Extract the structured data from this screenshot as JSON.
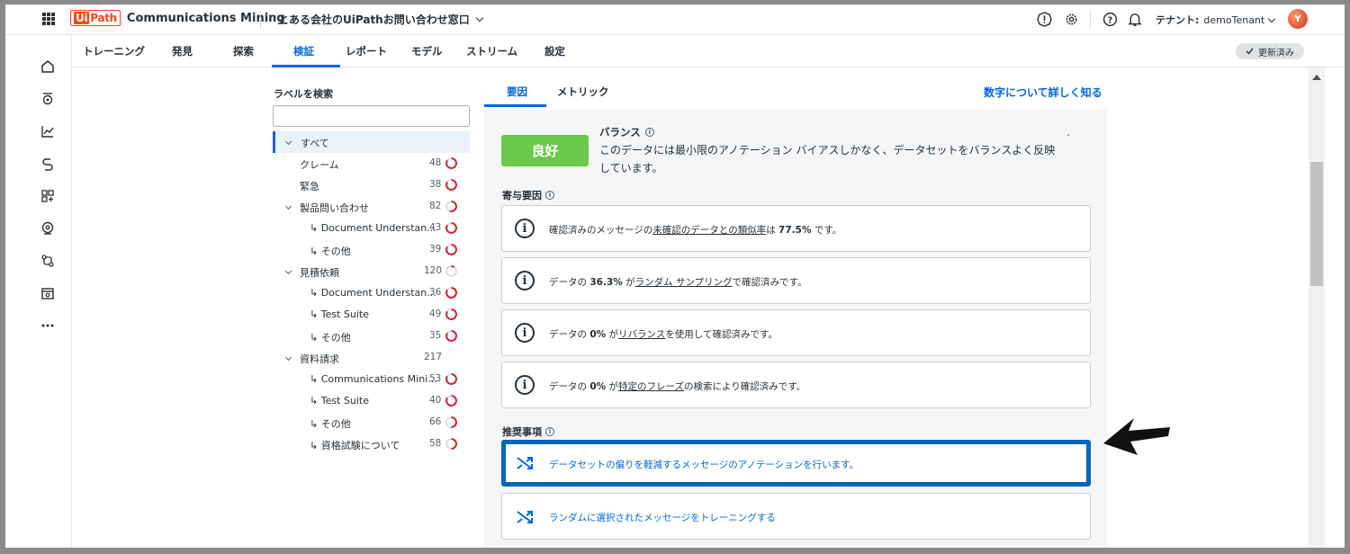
{
  "header": {
    "brand_ui": "Ui",
    "brand_path": "Path",
    "product": "Communications Mining",
    "project": "とある会社のUiPathお問い合わせ窓口",
    "tenant_label": "テナント:",
    "tenant_name": "demoTenant",
    "avatar_initial": "Y"
  },
  "nav": {
    "tabs": [
      "トレーニング",
      "発見",
      "探索",
      "検証",
      "レポート",
      "モデル",
      "ストリーム",
      "設定"
    ],
    "active": "検証",
    "status_badge": "更新済み"
  },
  "labels": {
    "title": "ラベルを検索",
    "search_value": "",
    "items": [
      {
        "name": "すべて",
        "count": "",
        "progress": null
      },
      {
        "name": "クレーム",
        "count": "48",
        "progress": 0.85
      },
      {
        "name": "緊急",
        "count": "38",
        "progress": 0.85
      },
      {
        "name": "製品問い合わせ",
        "count": "82",
        "progress": 0.55
      },
      {
        "name": "↳ Document Understan...",
        "count": "43",
        "progress": 0.85
      },
      {
        "name": "↳ その他",
        "count": "39",
        "progress": 0.85
      },
      {
        "name": "見積依頼",
        "count": "120",
        "progress": 0.1
      },
      {
        "name": "↳ Document Understan...",
        "count": "36",
        "progress": 0.85
      },
      {
        "name": "↳ Test Suite",
        "count": "49",
        "progress": 0.85
      },
      {
        "name": "↳ その他",
        "count": "35",
        "progress": 0.85
      },
      {
        "name": "資料請求",
        "count": "217",
        "progress": null
      },
      {
        "name": "↳ Communications Mini...",
        "count": "53",
        "progress": 0.85
      },
      {
        "name": "↳ Test Suite",
        "count": "40",
        "progress": 0.85
      },
      {
        "name": "↳ その他",
        "count": "66",
        "progress": 0.5
      },
      {
        "name": "↳ 資格試験について",
        "count": "58",
        "progress": 0.5
      }
    ]
  },
  "detail": {
    "tabs": [
      "要因",
      "メトリック"
    ],
    "active_tab": "要因",
    "learn_more": "数字について詳しく知る",
    "rating": "良好",
    "balance_title": "バランス",
    "balance_text": "このデータには最小限のアノテーション バイアスしかなく、データセットをバランスよく反映しています。",
    "balance_dash": "-",
    "factors_title": "寄与要因",
    "factors": [
      {
        "a": "確認済みのメッセージの",
        "link": "未確認のデータとの類似率",
        "b": "は ",
        "strong": "77.5%",
        "c": " です。"
      },
      {
        "a": "データの ",
        "strong": "36.3%",
        "b": " が",
        "link": "ランダム サンプリング",
        "c": "で確認済みです。"
      },
      {
        "a": "データの ",
        "strong": "0%",
        "b": " が",
        "link": "リバランス",
        "c": "を使用して確認済みです。"
      },
      {
        "a": "データの ",
        "strong": "0%",
        "b": " が",
        "link": "特定のフレーズ",
        "c": "の検索により確認済みです。"
      }
    ],
    "recs_title": "推奨事項",
    "recs": [
      "データセットの偏りを軽減するメッセージのアノテーションを行います。",
      "ランダムに選択されたメッセージをトレーニングする"
    ]
  },
  "colors": {
    "accent": "#0067df",
    "good": "#6cc84a",
    "brand": "#fa4616",
    "highlight_border": "#0067b8",
    "ring": "#d0202e"
  }
}
